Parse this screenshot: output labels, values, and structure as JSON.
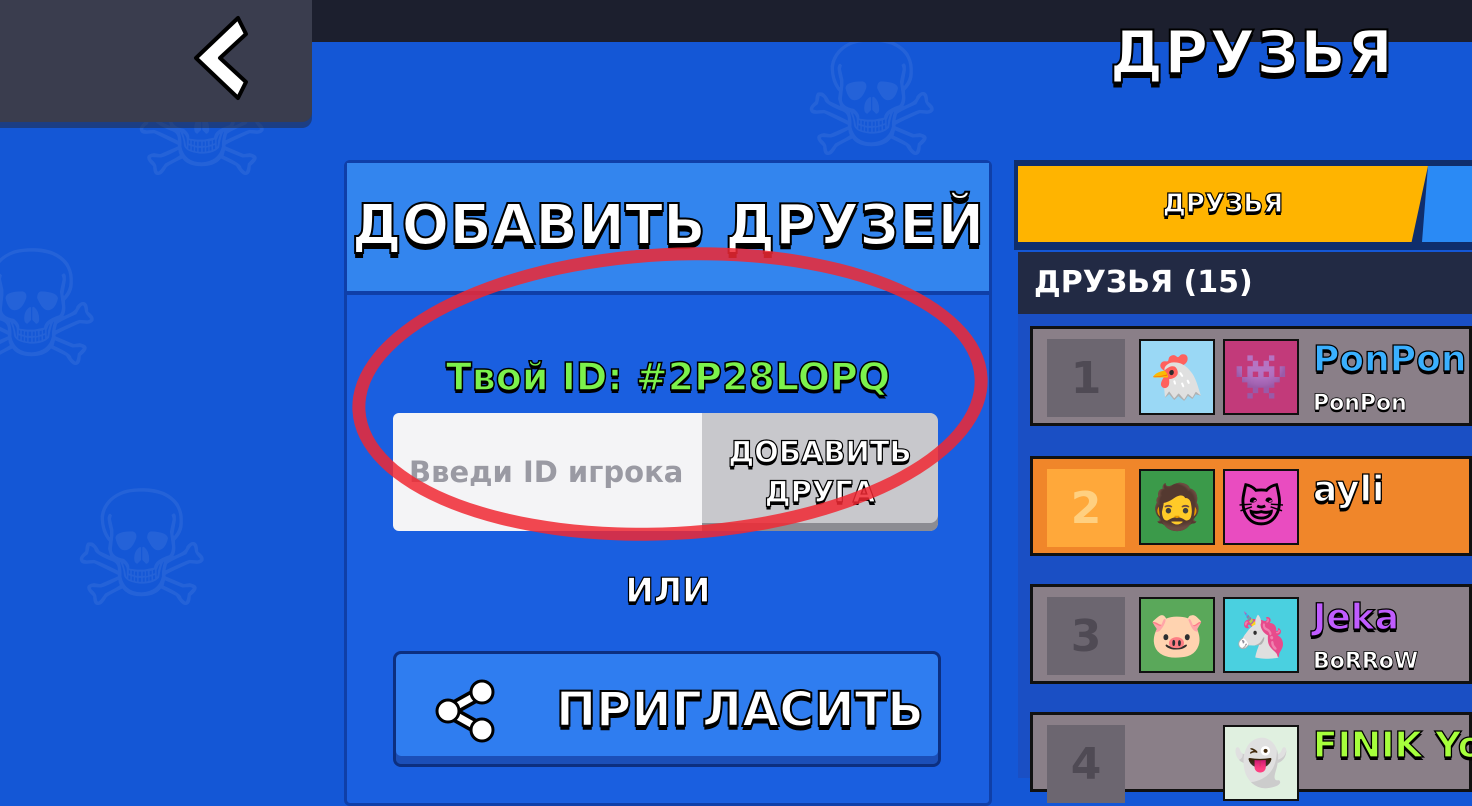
{
  "header": {
    "title": "ДРУЗЬЯ",
    "back_icon": "chevron-left-icon"
  },
  "add_panel": {
    "title": "ДОБАВИТЬ ДРУЗЕЙ",
    "your_id": "Твой ID: #2P28LOPQ",
    "input_placeholder": "Введи ID игрока",
    "input_value": "",
    "add_button_label_line1": "ДОБАВИТЬ",
    "add_button_label_line2": "ДРУГА",
    "or_label": "ИЛИ",
    "invite_label": "ПРИГЛАСИТЬ",
    "invite_icon": "share-icon"
  },
  "friends": {
    "tab_label": "ДРУЗЬЯ",
    "list_header": "ДРУЗЬЯ (15)",
    "items": [
      {
        "rank": "1",
        "name": "PonPon",
        "sub": "PonPon",
        "name_color": "#3ab0ff",
        "row_color": "#8a7f88",
        "rank_color": "#6c6670"
      },
      {
        "rank": "2",
        "name": "ayli",
        "sub": "",
        "name_color": "#ffffff",
        "row_color": "#f0862a",
        "rank_color": "#ffa83a"
      },
      {
        "rank": "3",
        "name": "Jeka",
        "sub": "BoRRoW",
        "name_color": "#c05cff",
        "row_color": "#8a7f88",
        "rank_color": "#6c6670"
      },
      {
        "rank": "4",
        "name": "FINIK Yo",
        "sub": "",
        "name_color": "#a6ff3c",
        "row_color": "#8a7f88",
        "rank_color": "#6c6670"
      }
    ]
  },
  "colors": {
    "background": "#1457d6",
    "accent_tab": "#ffb400",
    "id_text": "#7cf24c",
    "annotation": "#f02832"
  }
}
